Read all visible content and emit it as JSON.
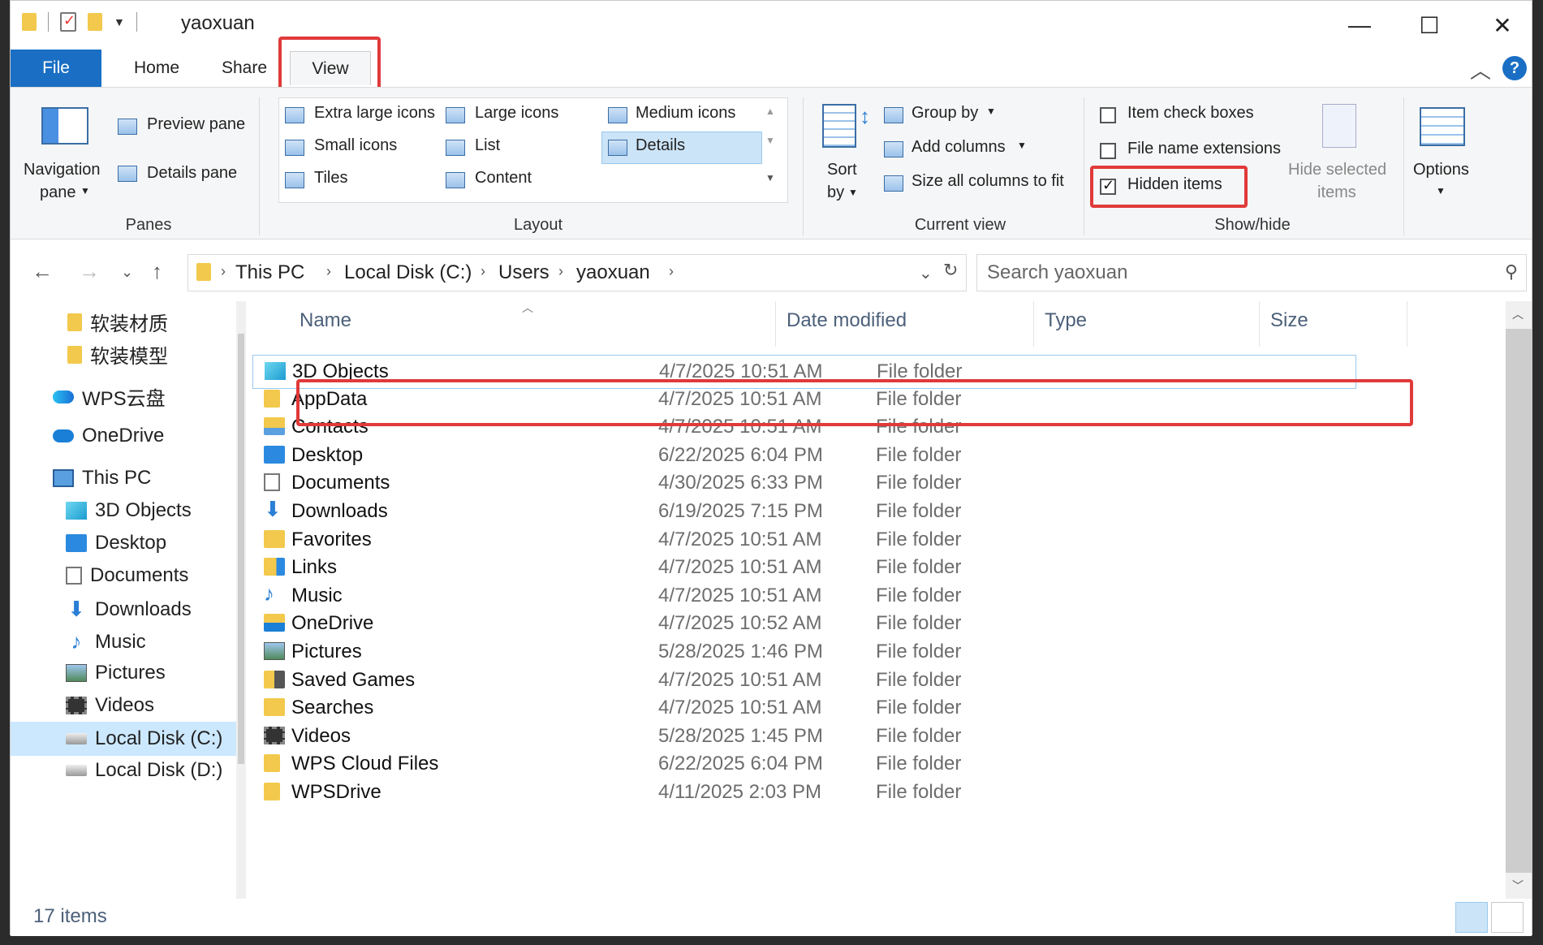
{
  "window": {
    "title": "yaoxuan",
    "minimize": "—",
    "maximize": "☐",
    "close": "✕"
  },
  "tabs": [
    {
      "label": "File"
    },
    {
      "label": "Home"
    },
    {
      "label": "Share"
    },
    {
      "label": "View"
    }
  ],
  "help_label": "?",
  "ribbon": {
    "panes": {
      "navigation_pane": "Navigation",
      "navigation_pane_2": "pane",
      "preview_pane": "Preview pane",
      "details_pane": "Details pane",
      "label": "Panes"
    },
    "layout": {
      "options": [
        "Extra large icons",
        "Large icons",
        "Medium icons",
        "Small icons",
        "List",
        "Details",
        "Tiles",
        "Content"
      ],
      "selected": "Details",
      "label": "Layout"
    },
    "current_view": {
      "sort_by": "Sort",
      "sort_by_2": "by",
      "group_by": "Group by",
      "add_columns": "Add columns",
      "size_all_columns": "Size all columns to fit",
      "label": "Current view"
    },
    "show_hide": {
      "item_check_boxes": "Item check boxes",
      "item_check_boxes_checked": false,
      "file_name_extensions": "File name extensions",
      "file_name_extensions_checked": false,
      "hidden_items": "Hidden items",
      "hidden_items_checked": true,
      "hide_selected": "Hide selected",
      "hide_selected_2": "items",
      "label": "Show/hide"
    },
    "options": "Options"
  },
  "address": {
    "crumbs": [
      "This PC",
      "Local Disk (C:)",
      "Users",
      "yaoxuan"
    ],
    "search_placeholder": "Search yaoxuan"
  },
  "nav": {
    "items": [
      {
        "label": "软装材质",
        "icon": "folder-icon"
      },
      {
        "label": "软装模型",
        "icon": "folder-icon"
      },
      {
        "label": "WPS云盘",
        "icon": "wps-cloud-icon"
      },
      {
        "label": "OneDrive",
        "icon": "onedrive-icon"
      },
      {
        "label": "This PC",
        "icon": "this-pc-icon"
      },
      {
        "label": "3D Objects",
        "icon": "3d-objects-icon"
      },
      {
        "label": "Desktop",
        "icon": "desktop-icon"
      },
      {
        "label": "Documents",
        "icon": "documents-icon"
      },
      {
        "label": "Downloads",
        "icon": "downloads-icon"
      },
      {
        "label": "Music",
        "icon": "music-icon"
      },
      {
        "label": "Pictures",
        "icon": "pictures-icon"
      },
      {
        "label": "Videos",
        "icon": "videos-icon"
      },
      {
        "label": "Local Disk (C:)",
        "icon": "local-disk-icon"
      },
      {
        "label": "Local Disk (D:)",
        "icon": "local-disk-icon"
      }
    ]
  },
  "columns": [
    "Name",
    "Date modified",
    "Type",
    "Size"
  ],
  "files": [
    {
      "name": "3D Objects",
      "date": "4/7/2025 10:51 AM",
      "type": "File folder",
      "icon": "3d-objects-icon"
    },
    {
      "name": "AppData",
      "date": "4/7/2025 10:51 AM",
      "type": "File folder",
      "icon": "folder-icon"
    },
    {
      "name": "Contacts",
      "date": "4/7/2025 10:51 AM",
      "type": "File folder",
      "icon": "contacts-icon"
    },
    {
      "name": "Desktop",
      "date": "6/22/2025 6:04 PM",
      "type": "File folder",
      "icon": "desktop-icon"
    },
    {
      "name": "Documents",
      "date": "4/30/2025 6:33 PM",
      "type": "File folder",
      "icon": "documents-icon"
    },
    {
      "name": "Downloads",
      "date": "6/19/2025 7:15 PM",
      "type": "File folder",
      "icon": "downloads-icon"
    },
    {
      "name": "Favorites",
      "date": "4/7/2025 10:51 AM",
      "type": "File folder",
      "icon": "favorites-icon"
    },
    {
      "name": "Links",
      "date": "4/7/2025 10:51 AM",
      "type": "File folder",
      "icon": "links-icon"
    },
    {
      "name": "Music",
      "date": "4/7/2025 10:51 AM",
      "type": "File folder",
      "icon": "music-icon"
    },
    {
      "name": "OneDrive",
      "date": "4/7/2025 10:52 AM",
      "type": "File folder",
      "icon": "onedrive-icon"
    },
    {
      "name": "Pictures",
      "date": "5/28/2025 1:46 PM",
      "type": "File folder",
      "icon": "pictures-icon"
    },
    {
      "name": "Saved Games",
      "date": "4/7/2025 10:51 AM",
      "type": "File folder",
      "icon": "saved-games-icon"
    },
    {
      "name": "Searches",
      "date": "4/7/2025 10:51 AM",
      "type": "File folder",
      "icon": "searches-icon"
    },
    {
      "name": "Videos",
      "date": "5/28/2025 1:45 PM",
      "type": "File folder",
      "icon": "videos-icon"
    },
    {
      "name": "WPS Cloud Files",
      "date": "6/22/2025 6:04 PM",
      "type": "File folder",
      "icon": "folder-icon"
    },
    {
      "name": "WPSDrive",
      "date": "4/11/2025 2:03 PM",
      "type": "File folder",
      "icon": "folder-icon"
    }
  ],
  "status": {
    "text": "17 items"
  },
  "colors": {
    "accent": "#1a6fc4",
    "highlight": "#e03a3a",
    "selection": "#cce4f7"
  }
}
